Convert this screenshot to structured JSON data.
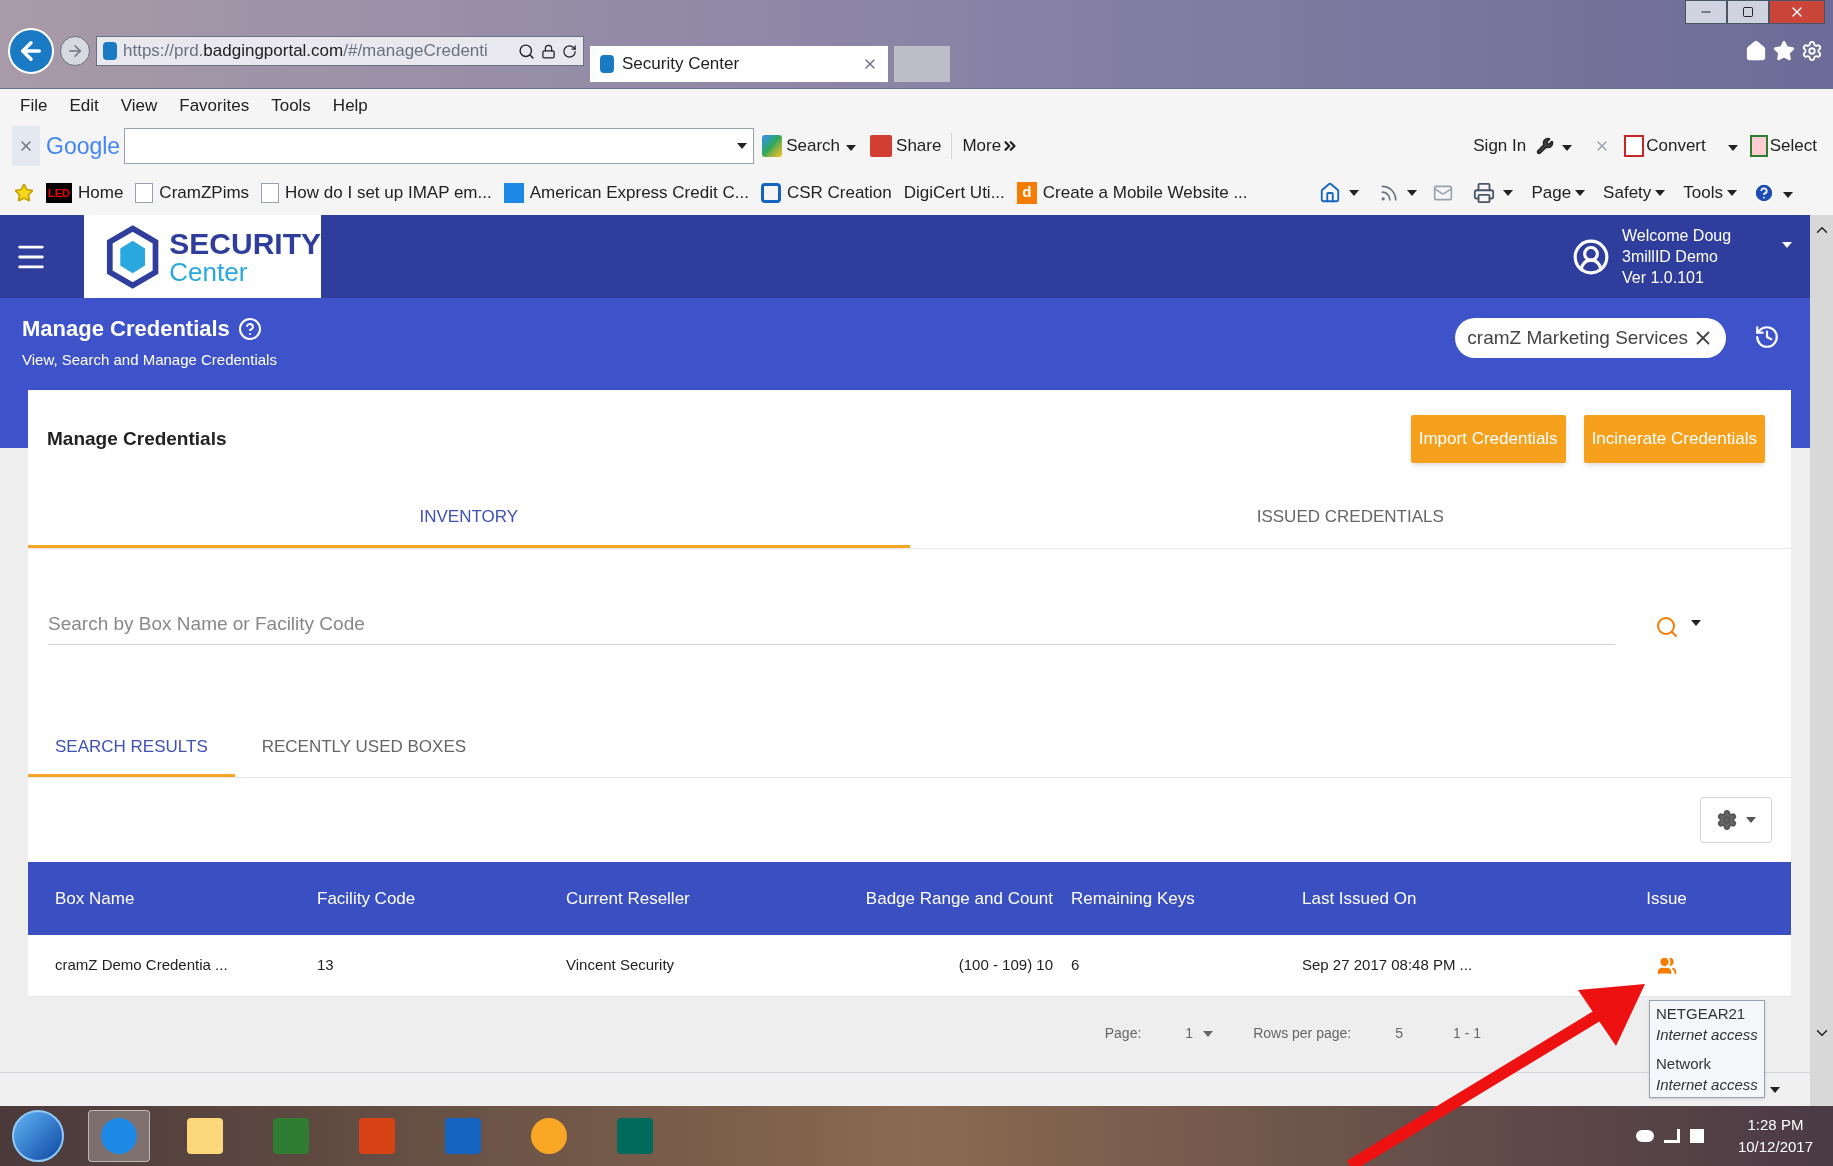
{
  "browser": {
    "url_prefix": "https://prd.",
    "url_domain": "badgingportal.com",
    "url_path": "/#/manageCredenti",
    "tab_title": "Security Center",
    "menu": [
      "File",
      "Edit",
      "View",
      "Favorites",
      "Tools",
      "Help"
    ],
    "toolbar": {
      "brand": "Google",
      "search": "Search",
      "share": "Share",
      "more": "More",
      "sign_in": "Sign In",
      "convert": "Convert",
      "select": "Select"
    },
    "favorites": [
      {
        "label": "Home",
        "kind": "led"
      },
      {
        "label": "CramZPims",
        "kind": "ie"
      },
      {
        "label": "How do I set up IMAP em...",
        "kind": "ie"
      },
      {
        "label": "American Express Credit C...",
        "kind": "square"
      },
      {
        "label": "CSR Creation",
        "kind": "ring"
      },
      {
        "label": "DigiCert Uti...",
        "kind": "none"
      },
      {
        "label": "Create a Mobile Website  ...",
        "kind": "d"
      }
    ],
    "favorites_logo": {
      "led": "LED",
      "d": "d"
    },
    "commands": [
      "Page",
      "Safety",
      "Tools"
    ]
  },
  "header": {
    "brand_top": "SECURITY",
    "brand_bottom": "Center",
    "welcome": "Welcome Doug",
    "org": "3millID Demo",
    "version": "Ver 1.0.101"
  },
  "page": {
    "title": "Manage Credentials",
    "subtitle": "View, Search and Manage Credentials",
    "filter_chip": "cramZ Marketing Services"
  },
  "card": {
    "title": "Manage Credentials",
    "buttons": [
      "Import Credentials",
      "Incinerate Credentials"
    ],
    "tabs": [
      {
        "label": "INVENTORY",
        "selected": true
      },
      {
        "label": "ISSUED CREDENTIALS",
        "selected": false
      }
    ],
    "search": {
      "placeholder": "Search by Box Name or Facility Code"
    },
    "subtabs": [
      {
        "label": "SEARCH RESULTS",
        "selected": true
      },
      {
        "label": "RECENTLY USED BOXES",
        "selected": false
      }
    ],
    "table": {
      "columns": [
        "Box Name",
        "Facility Code",
        "Current Reseller",
        "Badge Range and Count",
        "Remaining Keys",
        "Last Issued On",
        "Issue"
      ],
      "rows": [
        [
          "cramZ Demo Credentia ...",
          "13",
          "Vincent Security",
          "(100 - 109) 10",
          "6",
          "Sep 27 2017 08:48 PM ..."
        ]
      ]
    },
    "pagination": {
      "page_label": "Page:",
      "page": "1",
      "rows_label": "Rows per page:",
      "rows": "5",
      "range": "1 - 1"
    }
  },
  "network_popup": [
    {
      "name": "NETGEAR21",
      "status": "Internet access"
    },
    {
      "name": "Network",
      "status": "Internet access"
    }
  ],
  "taskbar": {
    "time": "1:28 PM",
    "date": "10/12/2017"
  }
}
